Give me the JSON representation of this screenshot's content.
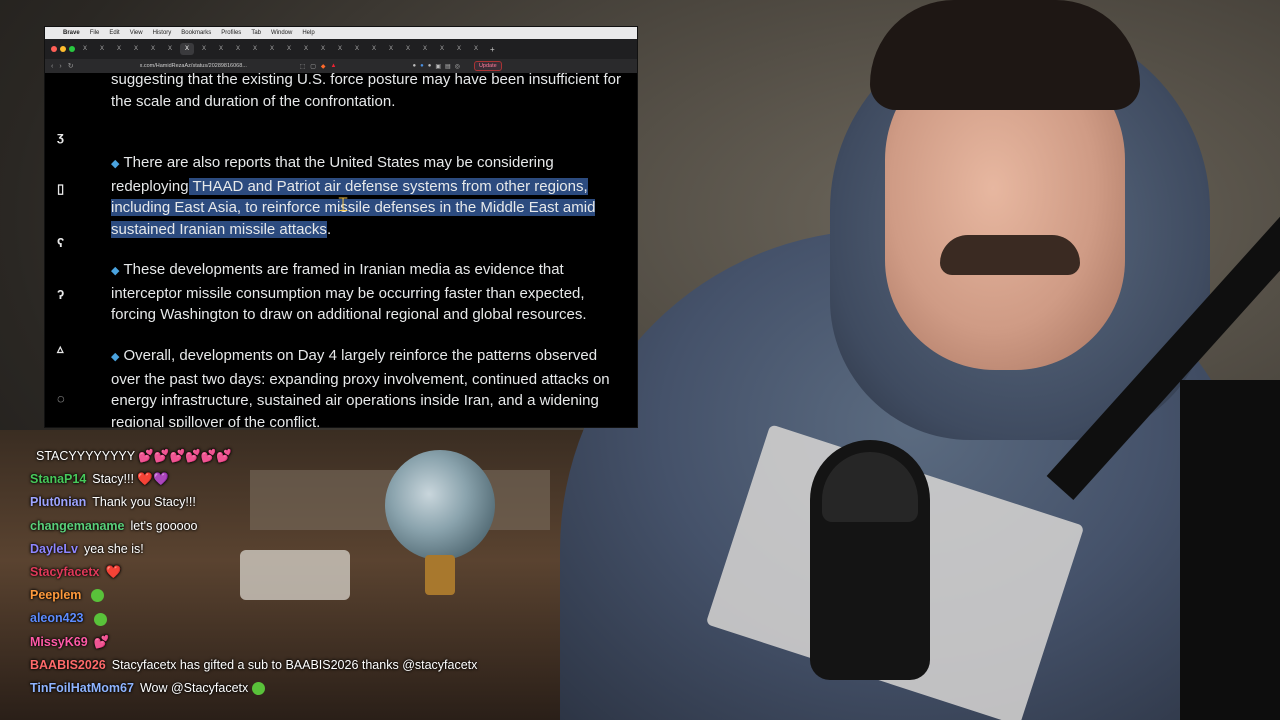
{
  "menubar": {
    "items": [
      "Brave",
      "File",
      "Edit",
      "View",
      "History",
      "Bookmarks",
      "Profiles",
      "Tab",
      "Window",
      "Help"
    ]
  },
  "browser": {
    "tab_glyph": "X",
    "url": "x.com/HamidRezaAz/status/20289816068...",
    "update_label": "Update"
  },
  "post": {
    "p1": "suggesting that the existing U.S. force posture may have been insufficient for the scale and duration of the confrontation.",
    "p2_pre": "There are also reports that the United States may be considering redeploying",
    "p2_hl": " THAAD and Patriot air defense systems from other regions, including East Asia, to reinforce missile defenses in the Middle East amid sustained Iranian missile attacks",
    "p2_post": ".",
    "p3": "These developments are framed in Iranian media as evidence that interceptor missile consumption may be occurring faster than expected, forcing Washington to draw on additional regional and global resources.",
    "p4": "Overall, developments on Day 4 largely reinforce the patterns observed over the past two days: expanding proxy involvement, continued attacks on energy infrastructure, sustained air operations inside Iran, and a widening regional spillover of the conflict.",
    "bullet": "◆"
  },
  "chat": [
    {
      "user": "",
      "color": "#e04b4b",
      "text": "STACYYYYYYYY 💕💕💕💕💕💕"
    },
    {
      "user": "StanaP14",
      "color": "#47c95a",
      "text": "Stacy!!! ❤️💜"
    },
    {
      "user": "Plut0nian",
      "color": "#9ea4ff",
      "text": "Thank you Stacy!!!"
    },
    {
      "user": "changemaname",
      "color": "#5ad07a",
      "text": "let's gooooo"
    },
    {
      "user": "DayleLv",
      "color": "#8e86ff",
      "text": "yea she is!"
    },
    {
      "user": "Stacyfacetx",
      "color": "#e0395a",
      "text": "❤️"
    },
    {
      "user": "Peeplem",
      "color": "#ff9a3c",
      "text": ""
    },
    {
      "user": "aleon423",
      "color": "#5d8cff",
      "text": ""
    },
    {
      "user": "MissyK69",
      "color": "#ff5aa6",
      "text": "💕"
    },
    {
      "user": "BAABIS2026",
      "color": "#ff6a6a",
      "text": "Stacyfacetx has gifted a sub to BAABIS2026 thanks @stacyfacetx"
    },
    {
      "user": "TinFoilHatMom67",
      "color": "#8fb4ff",
      "text": "Wow @Stacyfacetx"
    }
  ]
}
